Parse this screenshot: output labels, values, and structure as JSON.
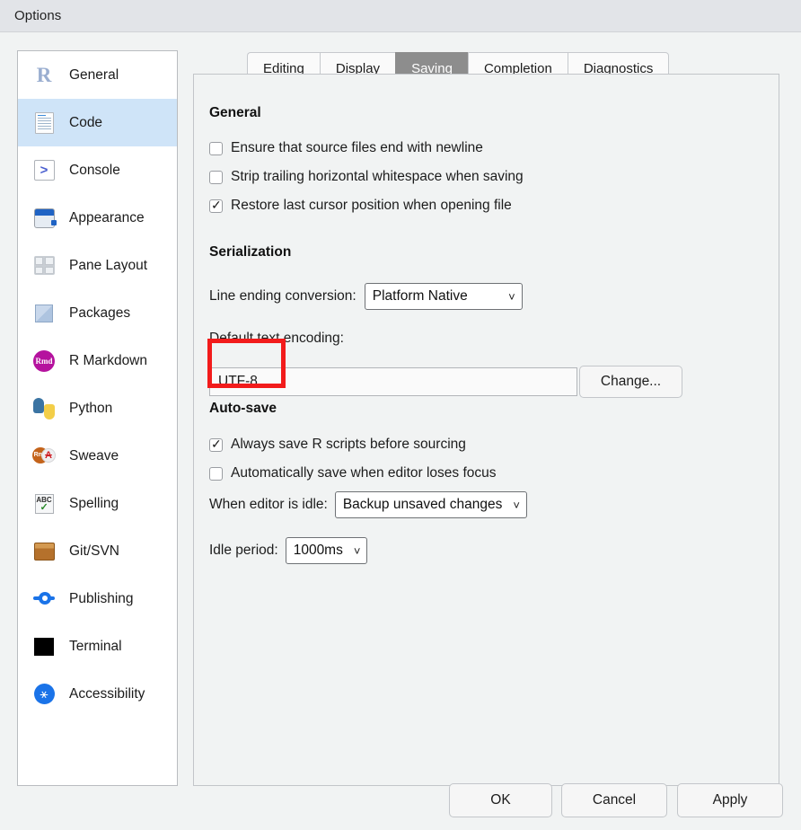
{
  "window": {
    "title": "Options"
  },
  "sidebar": {
    "items": [
      {
        "label": "General",
        "icon": "r-logo-icon",
        "selected": false
      },
      {
        "label": "Code",
        "icon": "code-document-icon",
        "selected": true
      },
      {
        "label": "Console",
        "icon": "console-prompt-icon",
        "selected": false
      },
      {
        "label": "Appearance",
        "icon": "paint-bucket-icon",
        "selected": false
      },
      {
        "label": "Pane Layout",
        "icon": "pane-grid-icon",
        "selected": false
      },
      {
        "label": "Packages",
        "icon": "package-box-icon",
        "selected": false
      },
      {
        "label": "R Markdown",
        "icon": "rmd-badge-icon",
        "selected": false
      },
      {
        "label": "Python",
        "icon": "python-logo-icon",
        "selected": false
      },
      {
        "label": "Sweave",
        "icon": "sweave-pdf-icon",
        "selected": false
      },
      {
        "label": "Spelling",
        "icon": "abc-check-icon",
        "selected": false
      },
      {
        "label": "Git/SVN",
        "icon": "box-icon",
        "selected": false
      },
      {
        "label": "Publishing",
        "icon": "publish-icon",
        "selected": false
      },
      {
        "label": "Terminal",
        "icon": "terminal-icon",
        "selected": false
      },
      {
        "label": "Accessibility",
        "icon": "accessibility-icon",
        "selected": false
      }
    ]
  },
  "tabs": [
    {
      "label": "Editing",
      "active": false
    },
    {
      "label": "Display",
      "active": false
    },
    {
      "label": "Saving",
      "active": true
    },
    {
      "label": "Completion",
      "active": false
    },
    {
      "label": "Diagnostics",
      "active": false
    }
  ],
  "saving": {
    "general": {
      "heading": "General",
      "checkboxes": [
        {
          "label": "Ensure that source files end with newline",
          "checked": false
        },
        {
          "label": "Strip trailing horizontal whitespace when saving",
          "checked": false
        },
        {
          "label": "Restore last cursor position when opening file",
          "checked": true
        }
      ]
    },
    "serialization": {
      "heading": "Serialization",
      "line_ending_label": "Line ending conversion:",
      "line_ending_value": "Platform Native",
      "encoding_label": "Default text encoding:",
      "encoding_value": "UTF-8",
      "change_button": "Change..."
    },
    "autosave": {
      "heading": "Auto-save",
      "checkboxes": [
        {
          "label": "Always save R scripts before sourcing",
          "checked": true
        },
        {
          "label": "Automatically save when editor loses focus",
          "checked": false
        }
      ],
      "idle_action_label": "When editor is idle:",
      "idle_action_value": "Backup unsaved changes",
      "idle_period_label": "Idle period:",
      "idle_period_value": "1000ms"
    }
  },
  "footer": {
    "ok": "OK",
    "cancel": "Cancel",
    "apply": "Apply"
  },
  "colors": {
    "accent_selected": "#cfe4f8",
    "tab_active_bg": "#8d8d8d",
    "highlight": "#f21b1b",
    "dialog_bg": "#f1f3f3",
    "titlebar_bg": "#e2e4e8"
  },
  "icons": {
    "caret_down": "⌄",
    "check": "✓"
  }
}
